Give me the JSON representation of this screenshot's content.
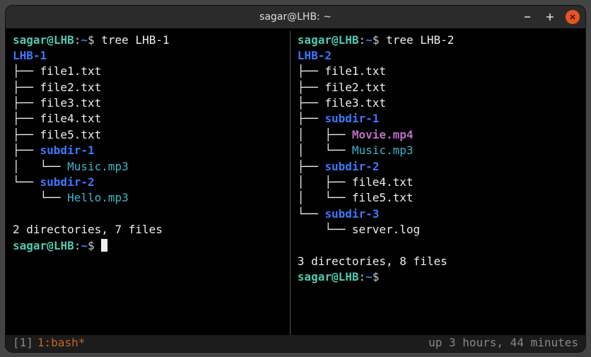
{
  "titlebar": {
    "title": "sagar@LHB: ~",
    "minimize_icon": "−",
    "maximize_icon": "+",
    "close_icon": "×"
  },
  "prompt": {
    "user": "sagar",
    "at": "@",
    "host": "LHB",
    "colon": ":",
    "path": "~",
    "symbol": "$"
  },
  "left": {
    "command": "tree LHB-1",
    "root": "LHB-1",
    "lines": [
      {
        "prefix": "├── ",
        "name": "file1.txt",
        "cls": ""
      },
      {
        "prefix": "├── ",
        "name": "file2.txt",
        "cls": ""
      },
      {
        "prefix": "├── ",
        "name": "file3.txt",
        "cls": ""
      },
      {
        "prefix": "├── ",
        "name": "file4.txt",
        "cls": ""
      },
      {
        "prefix": "├── ",
        "name": "file5.txt",
        "cls": ""
      },
      {
        "prefix": "├── ",
        "name": "subdir-1",
        "cls": "dir"
      },
      {
        "prefix": "│   └── ",
        "name": "Music.mp3",
        "cls": "audio"
      },
      {
        "prefix": "└── ",
        "name": "subdir-2",
        "cls": "dir"
      },
      {
        "prefix": "    └── ",
        "name": "Hello.mp3",
        "cls": "audio"
      }
    ],
    "summary": "2 directories, 7 files"
  },
  "right": {
    "command": "tree LHB-2",
    "root": "LHB-2",
    "lines": [
      {
        "prefix": "├── ",
        "name": "file1.txt",
        "cls": ""
      },
      {
        "prefix": "├── ",
        "name": "file2.txt",
        "cls": ""
      },
      {
        "prefix": "├── ",
        "name": "file3.txt",
        "cls": ""
      },
      {
        "prefix": "├── ",
        "name": "subdir-1",
        "cls": "dir"
      },
      {
        "prefix": "│   ├── ",
        "name": "Movie.mp4",
        "cls": "video"
      },
      {
        "prefix": "│   └── ",
        "name": "Music.mp3",
        "cls": "audio"
      },
      {
        "prefix": "├── ",
        "name": "subdir-2",
        "cls": "dir"
      },
      {
        "prefix": "│   ├── ",
        "name": "file4.txt",
        "cls": ""
      },
      {
        "prefix": "│   └── ",
        "name": "file5.txt",
        "cls": ""
      },
      {
        "prefix": "└── ",
        "name": "subdir-3",
        "cls": "dir"
      },
      {
        "prefix": "    └── ",
        "name": "server.log",
        "cls": ""
      }
    ],
    "summary": "3 directories, 8 files"
  },
  "status": {
    "session": "[1]",
    "window": "1:bash*",
    "uptime": "up 3 hours, 44 minutes"
  }
}
